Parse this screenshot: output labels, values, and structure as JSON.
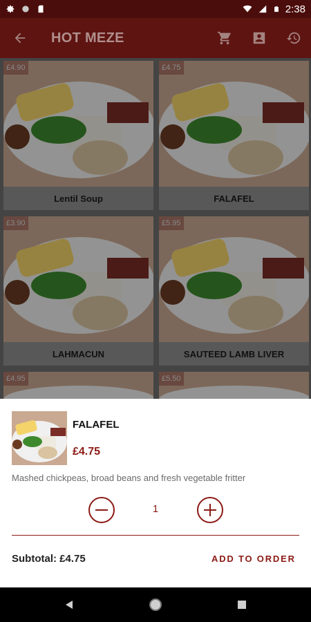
{
  "status_bar": {
    "time": "2:38",
    "icons": [
      "settings-icon",
      "record-icon",
      "sim-card-icon",
      "wifi-icon",
      "signal-icon",
      "battery-icon"
    ]
  },
  "app_bar": {
    "title": "HOT MEZE",
    "icons": [
      "back-arrow-icon",
      "cart-icon",
      "account-box-icon",
      "history-icon"
    ]
  },
  "menu_items": [
    {
      "price": "£4.90",
      "name": "Lentil Soup"
    },
    {
      "price": "£4.75",
      "name": "FALAFEL"
    },
    {
      "price": "£3.90",
      "name": "LAHMACUN"
    },
    {
      "price": "£5.95",
      "name": "SAUTEED LAMB LIVER"
    },
    {
      "price": "£4.95",
      "name": ""
    },
    {
      "price": "£5.50",
      "name": ""
    }
  ],
  "sheet": {
    "name": "FALAFEL",
    "price": "£4.75",
    "description": "Mashed chickpeas, broad beans and fresh vegetable fritter",
    "quantity": "1",
    "subtotal": "Subtotal: £4.75",
    "add_label": "ADD TO ORDER"
  },
  "colors": {
    "accent": "#8b1a14",
    "app_bar": "#5e1411",
    "status_bar": "#4a0d0b"
  },
  "nav_bar": {
    "icons": [
      "back-triangle-icon",
      "home-circle-icon",
      "recents-square-icon"
    ]
  }
}
